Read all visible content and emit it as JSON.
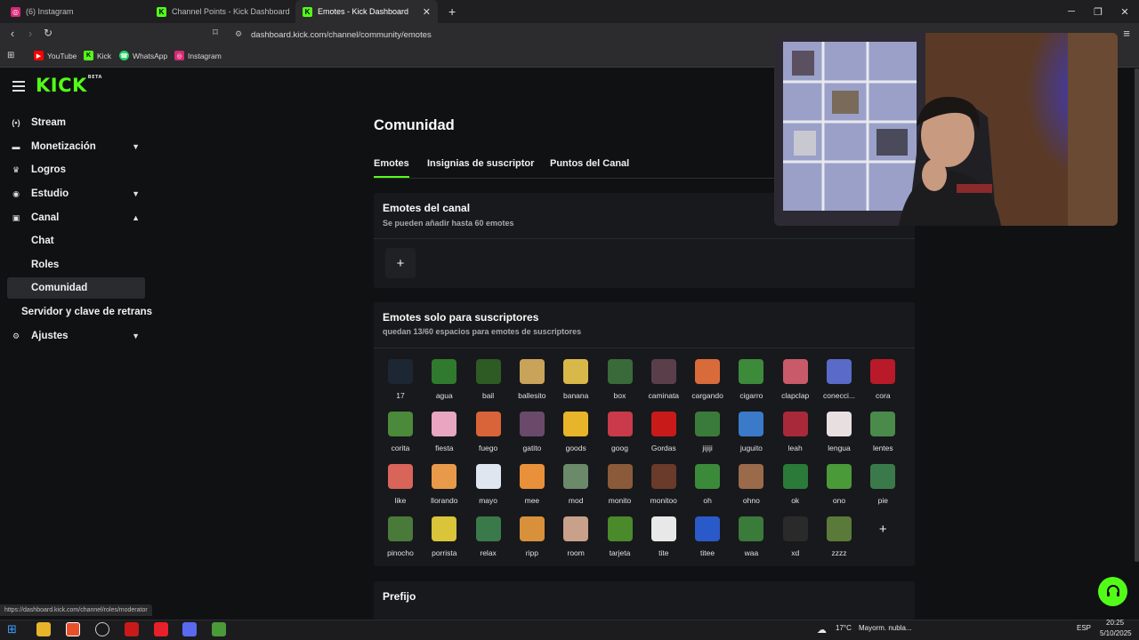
{
  "browser": {
    "tabs": [
      {
        "title": "(6) Instagram",
        "favicon": "instagram-icon",
        "active": false
      },
      {
        "title": "Channel Points - Kick Dashboard",
        "favicon": "kick-icon",
        "active": false
      },
      {
        "title": "Emotes - Kick Dashboard",
        "favicon": "kick-icon",
        "active": true
      }
    ],
    "url": "dashboard.kick.com/channel/community/emotes",
    "bookmarks": [
      {
        "label": "YouTube",
        "icon": "youtube-icon"
      },
      {
        "label": "Kick",
        "icon": "kick-icon"
      },
      {
        "label": "WhatsApp",
        "icon": "whatsapp-icon"
      },
      {
        "label": "Instagram",
        "icon": "instagram-icon"
      }
    ],
    "status_url": "https://dashboard.kick.com/channel/roles/moderator"
  },
  "brand": {
    "logo": "KICK",
    "logo_badge": "BETA",
    "accent": "#53fc18"
  },
  "sidebar": {
    "items": [
      {
        "label": "Stream",
        "icon": "stream-icon",
        "chevron": ""
      },
      {
        "label": "Monetización",
        "icon": "monetization-icon",
        "chevron": "down"
      },
      {
        "label": "Logros",
        "icon": "trophy-icon",
        "chevron": ""
      },
      {
        "label": "Estudio",
        "icon": "studio-icon",
        "chevron": "down"
      },
      {
        "label": "Canal",
        "icon": "channel-icon",
        "chevron": "up"
      },
      {
        "label": "Chat",
        "icon": "",
        "chevron": ""
      },
      {
        "label": "Roles",
        "icon": "",
        "chevron": ""
      },
      {
        "label": "Comunidad",
        "icon": "",
        "chevron": "",
        "active": true
      },
      {
        "label": "Servidor y clave de retrans",
        "icon": "",
        "chevron": ""
      },
      {
        "label": "Ajustes",
        "icon": "gear-icon",
        "chevron": "down"
      }
    ]
  },
  "main": {
    "title": "Comunidad",
    "tabs": [
      {
        "label": "Emotes",
        "active": true
      },
      {
        "label": "Insignias de suscriptor",
        "active": false
      },
      {
        "label": "Puntos del Canal",
        "active": false
      }
    ],
    "channel_emotes": {
      "title": "Emotes del canal",
      "subtitle": "Se pueden añadir hasta 60 emotes",
      "add_label": "+"
    },
    "sub_emotes": {
      "title": "Emotes solo para suscriptores",
      "subtitle": "quedan 13/60 espacios para emotes de suscriptores",
      "add_label": "+",
      "emotes": [
        {
          "name": "17",
          "color": "#1d2633"
        },
        {
          "name": "agua",
          "color": "#2f7a2d"
        },
        {
          "name": "bail",
          "color": "#2e5a24"
        },
        {
          "name": "ballesito",
          "color": "#c9a35a"
        },
        {
          "name": "banana",
          "color": "#d9b84a"
        },
        {
          "name": "box",
          "color": "#3a6a3a"
        },
        {
          "name": "caminata",
          "color": "#5a3f4a"
        },
        {
          "name": "cargando",
          "color": "#d96b3a"
        },
        {
          "name": "cigarro",
          "color": "#3d8a3a"
        },
        {
          "name": "clapclap",
          "color": "#c95a6a"
        },
        {
          "name": "conecci...",
          "color": "#5a6ac9"
        },
        {
          "name": "cora",
          "color": "#b81a2a"
        },
        {
          "name": "corita",
          "color": "#4a8a3a"
        },
        {
          "name": "fiesta",
          "color": "#e8a6c0"
        },
        {
          "name": "fuego",
          "color": "#d9643a"
        },
        {
          "name": "gatito",
          "color": "#6a4a6a"
        },
        {
          "name": "goods",
          "color": "#e8b42a"
        },
        {
          "name": "goog",
          "color": "#c93a4a"
        },
        {
          "name": "Gordas",
          "color": "#c91a1a"
        },
        {
          "name": "jijiji",
          "color": "#3a7a3a"
        },
        {
          "name": "juguito",
          "color": "#3a7ac9"
        },
        {
          "name": "leah",
          "color": "#a82a3a"
        },
        {
          "name": "lengua",
          "color": "#e8e0e0"
        },
        {
          "name": "lentes",
          "color": "#4a8a4a"
        },
        {
          "name": "like",
          "color": "#d9645a"
        },
        {
          "name": "llorando",
          "color": "#e89a4a"
        },
        {
          "name": "mayo",
          "color": "#dfe6f0"
        },
        {
          "name": "mee",
          "color": "#e8903a"
        },
        {
          "name": "mod",
          "color": "#6a8a6a"
        },
        {
          "name": "monito",
          "color": "#8a5a3a"
        },
        {
          "name": "monitoo",
          "color": "#6a3a2a"
        },
        {
          "name": "oh",
          "color": "#3a8a3a"
        },
        {
          "name": "ohno",
          "color": "#9a6a4a"
        },
        {
          "name": "ok",
          "color": "#2a7a3a"
        },
        {
          "name": "ono",
          "color": "#4a9a3a"
        },
        {
          "name": "pie",
          "color": "#3a7a4a"
        },
        {
          "name": "pinocho",
          "color": "#4a7a3a"
        },
        {
          "name": "porrista",
          "color": "#d9c43a"
        },
        {
          "name": "relax",
          "color": "#3a7a4a"
        },
        {
          "name": "ripp",
          "color": "#d9903a"
        },
        {
          "name": "room",
          "color": "#c9a08a"
        },
        {
          "name": "tarjeta",
          "color": "#4a8a2a"
        },
        {
          "name": "tite",
          "color": "#e8e8e8"
        },
        {
          "name": "titee",
          "color": "#2a5ac9"
        },
        {
          "name": "waa",
          "color": "#3a7a3a"
        },
        {
          "name": "xd",
          "color": "#2a2a2a"
        },
        {
          "name": "zzzz",
          "color": "#5a7a3a"
        }
      ]
    },
    "prefix": {
      "title": "Prefijo"
    }
  },
  "taskbar": {
    "weather_temp": "17°C",
    "weather_text": "Mayorm. nubla...",
    "lang": "ESP",
    "time": "20:25",
    "date": "5/10/2025"
  }
}
